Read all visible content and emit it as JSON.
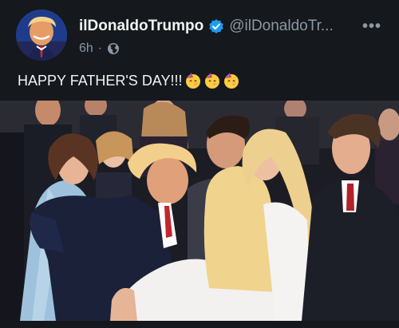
{
  "post": {
    "display_name": "ilDonaldoTrumpo",
    "handle": "@ilDonaldoTr...",
    "time": "6h",
    "separator": "·",
    "more_label": "•••",
    "text": "HAPPY FATHER'S DAY!!!"
  },
  "icons": {
    "verified": "verified-badge-icon",
    "audience": "globe-icon",
    "emoji": "partying-face-emoji",
    "more": "more-options-icon"
  },
  "colors": {
    "background": "#15181c",
    "verified_blue": "#1d9bf0",
    "secondary_text": "#8b98a5"
  }
}
